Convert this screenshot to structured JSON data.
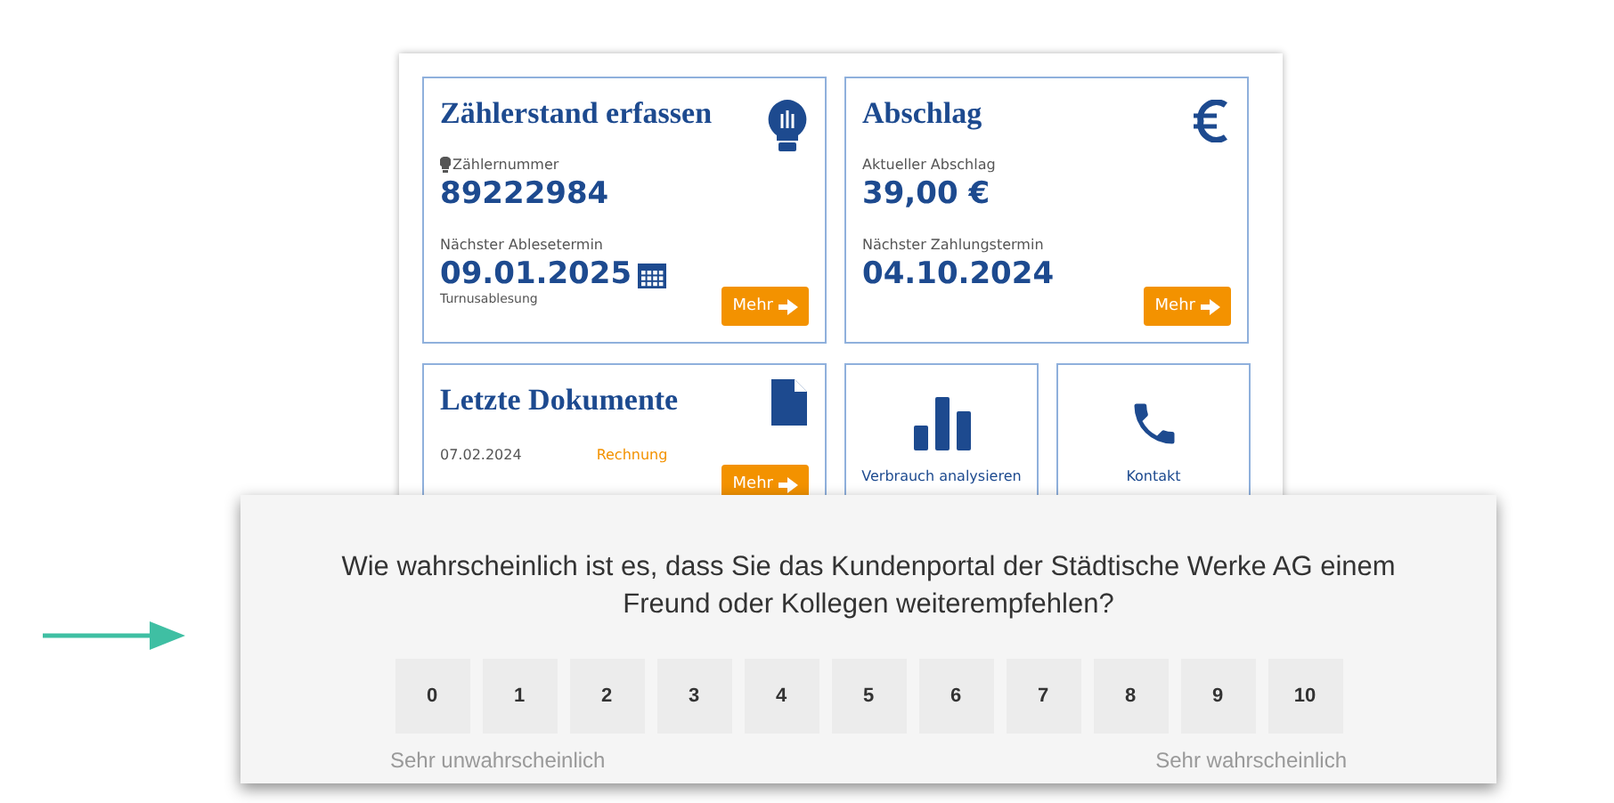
{
  "cards": [
    {
      "kind": "meter",
      "title": "Zählerstand erfassen",
      "meter_label": "Zählernummer",
      "meter_number": "89222984",
      "date_label": "Nächster Ablesetermin",
      "date": "09.01.2025",
      "note": "Turnusablesung",
      "button": "Mehr"
    },
    {
      "kind": "payment",
      "title": "Abschlag",
      "amount_label": "Aktueller Abschlag",
      "amount": "39,00 €",
      "date_label": "Nächster Zahlungstermin",
      "date": "04.10.2024",
      "button": "Mehr"
    }
  ],
  "documents": {
    "title": "Letzte Dokumente",
    "items": [
      {
        "date": "07.02.2024",
        "type": "Rechnung"
      }
    ],
    "button": "Mehr"
  },
  "tiles": [
    {
      "kind": "chart",
      "label": "Verbrauch analysieren"
    },
    {
      "kind": "phone",
      "label": "Kontakt"
    }
  ],
  "survey": {
    "question": "Wie wahrscheinlich ist es, dass Sie das Kundenportal der Städtische Werke AG einem Freund oder Kollegen weiterempfehlen?",
    "scores": [
      "0",
      "1",
      "2",
      "3",
      "4",
      "5",
      "6",
      "7",
      "8",
      "9",
      "10"
    ],
    "low_label": "Sehr unwahrscheinlich",
    "high_label": "Sehr wahrscheinlich"
  }
}
